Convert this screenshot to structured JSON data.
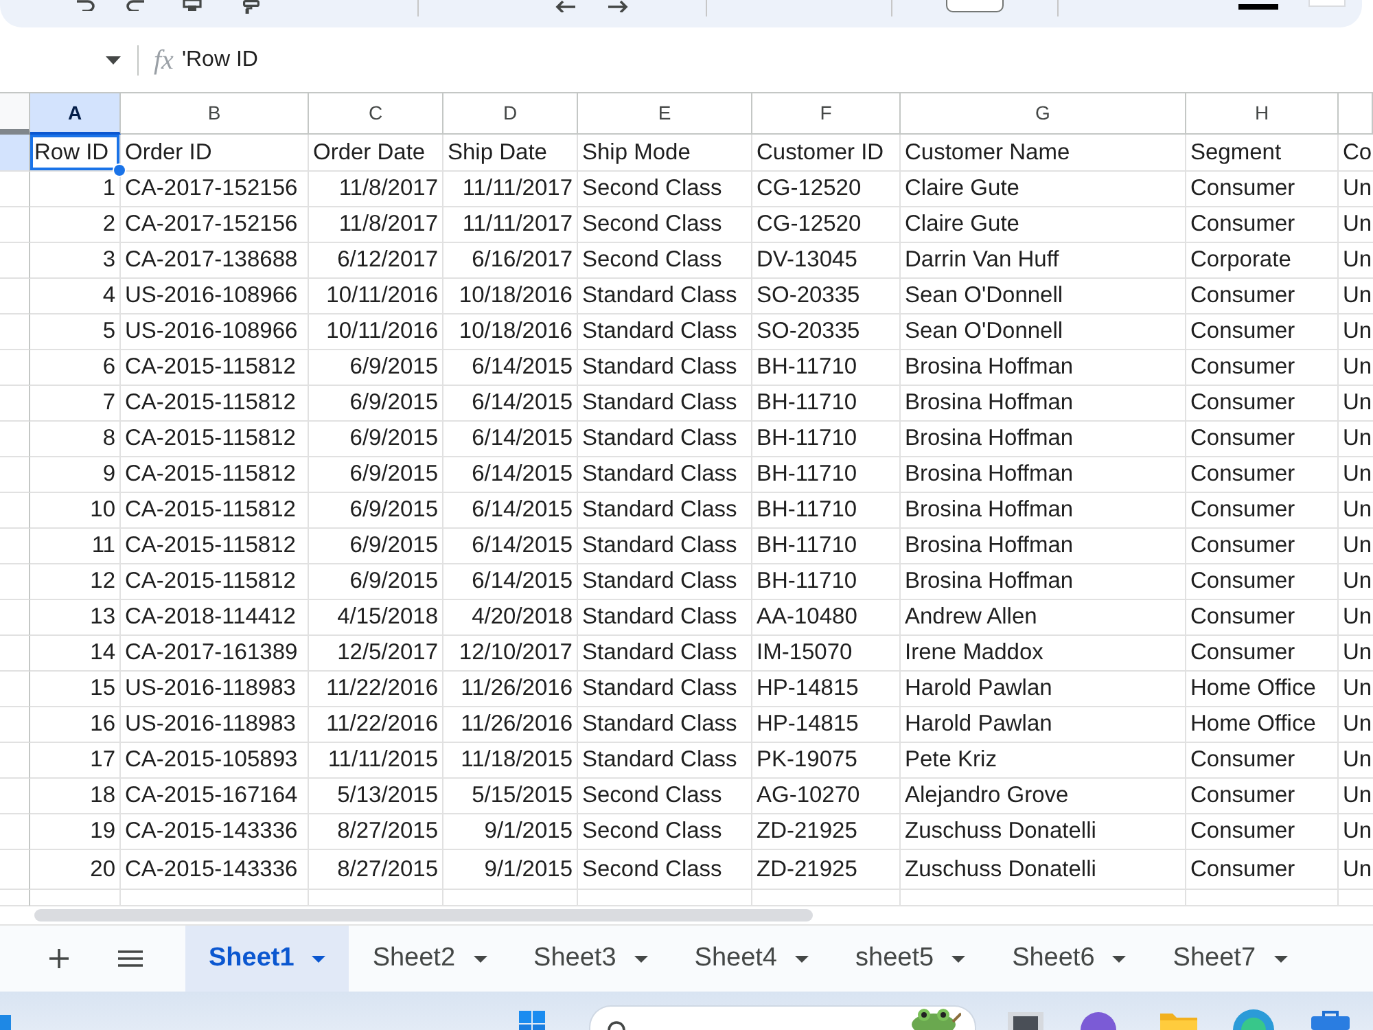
{
  "formula_bar": {
    "function_symbol": "fx",
    "formula": "'Row ID"
  },
  "grid": {
    "columns": [
      {
        "letter": "A",
        "selected": true,
        "kind": "number"
      },
      {
        "letter": "B",
        "selected": false,
        "kind": "text"
      },
      {
        "letter": "C",
        "selected": false,
        "kind": "date"
      },
      {
        "letter": "D",
        "selected": false,
        "kind": "date"
      },
      {
        "letter": "E",
        "selected": false,
        "kind": "text"
      },
      {
        "letter": "F",
        "selected": false,
        "kind": "text"
      },
      {
        "letter": "G",
        "selected": false,
        "kind": "text"
      },
      {
        "letter": "H",
        "selected": false,
        "kind": "text"
      },
      {
        "selected": false,
        "kind": "text"
      }
    ],
    "rows": [
      {
        "kind": "header",
        "selected": true,
        "cells": [
          "Row ID",
          "Order ID",
          "Order Date",
          "Ship Date",
          "Ship Mode",
          "Customer ID",
          "Customer Name",
          "Segment",
          "Co"
        ]
      },
      {
        "kind": "data",
        "selected": false,
        "cells": [
          "1",
          "CA-2017-152156",
          "11/8/2017",
          "11/11/2017",
          "Second Class",
          "CG-12520",
          "Claire Gute",
          "Consumer",
          "Un"
        ]
      },
      {
        "kind": "data",
        "selected": false,
        "cells": [
          "2",
          "CA-2017-152156",
          "11/8/2017",
          "11/11/2017",
          "Second Class",
          "CG-12520",
          "Claire Gute",
          "Consumer",
          "Un"
        ]
      },
      {
        "kind": "data",
        "selected": false,
        "cells": [
          "3",
          "CA-2017-138688",
          "6/12/2017",
          "6/16/2017",
          "Second Class",
          "DV-13045",
          "Darrin Van Huff",
          "Corporate",
          "Un"
        ]
      },
      {
        "kind": "data",
        "selected": false,
        "cells": [
          "4",
          "US-2016-108966",
          "10/11/2016",
          "10/18/2016",
          "Standard Class",
          "SO-20335",
          "Sean O'Donnell",
          "Consumer",
          "Un"
        ]
      },
      {
        "kind": "data",
        "selected": false,
        "cells": [
          "5",
          "US-2016-108966",
          "10/11/2016",
          "10/18/2016",
          "Standard Class",
          "SO-20335",
          "Sean O'Donnell",
          "Consumer",
          "Un"
        ]
      },
      {
        "kind": "data",
        "selected": false,
        "cells": [
          "6",
          "CA-2015-115812",
          "6/9/2015",
          "6/14/2015",
          "Standard Class",
          "BH-11710",
          "Brosina Hoffman",
          "Consumer",
          "Un"
        ]
      },
      {
        "kind": "data",
        "selected": false,
        "cells": [
          "7",
          "CA-2015-115812",
          "6/9/2015",
          "6/14/2015",
          "Standard Class",
          "BH-11710",
          "Brosina Hoffman",
          "Consumer",
          "Un"
        ]
      },
      {
        "kind": "data",
        "selected": false,
        "cells": [
          "8",
          "CA-2015-115812",
          "6/9/2015",
          "6/14/2015",
          "Standard Class",
          "BH-11710",
          "Brosina Hoffman",
          "Consumer",
          "Un"
        ]
      },
      {
        "kind": "data",
        "selected": false,
        "cells": [
          "9",
          "CA-2015-115812",
          "6/9/2015",
          "6/14/2015",
          "Standard Class",
          "BH-11710",
          "Brosina Hoffman",
          "Consumer",
          "Un"
        ]
      },
      {
        "kind": "data",
        "selected": false,
        "cells": [
          "10",
          "CA-2015-115812",
          "6/9/2015",
          "6/14/2015",
          "Standard Class",
          "BH-11710",
          "Brosina Hoffman",
          "Consumer",
          "Un"
        ]
      },
      {
        "kind": "data",
        "selected": false,
        "cells": [
          "11",
          "CA-2015-115812",
          "6/9/2015",
          "6/14/2015",
          "Standard Class",
          "BH-11710",
          "Brosina Hoffman",
          "Consumer",
          "Un"
        ]
      },
      {
        "kind": "data",
        "selected": false,
        "cells": [
          "12",
          "CA-2015-115812",
          "6/9/2015",
          "6/14/2015",
          "Standard Class",
          "BH-11710",
          "Brosina Hoffman",
          "Consumer",
          "Un"
        ]
      },
      {
        "kind": "data",
        "selected": false,
        "cells": [
          "13",
          "CA-2018-114412",
          "4/15/2018",
          "4/20/2018",
          "Standard Class",
          "AA-10480",
          "Andrew Allen",
          "Consumer",
          "Un"
        ]
      },
      {
        "kind": "data",
        "selected": false,
        "cells": [
          "14",
          "CA-2017-161389",
          "12/5/2017",
          "12/10/2017",
          "Standard Class",
          "IM-15070",
          "Irene Maddox",
          "Consumer",
          "Un"
        ]
      },
      {
        "kind": "data",
        "selected": false,
        "cells": [
          "15",
          "US-2016-118983",
          "11/22/2016",
          "11/26/2016",
          "Standard Class",
          "HP-14815",
          "Harold Pawlan",
          "Home Office",
          "Un"
        ]
      },
      {
        "kind": "data",
        "selected": false,
        "cells": [
          "16",
          "US-2016-118983",
          "11/22/2016",
          "11/26/2016",
          "Standard Class",
          "HP-14815",
          "Harold Pawlan",
          "Home Office",
          "Un"
        ]
      },
      {
        "kind": "data",
        "selected": false,
        "cells": [
          "17",
          "CA-2015-105893",
          "11/11/2015",
          "11/18/2015",
          "Standard Class",
          "PK-19075",
          "Pete Kriz",
          "Consumer",
          "Un"
        ]
      },
      {
        "kind": "data",
        "selected": false,
        "cells": [
          "18",
          "CA-2015-167164",
          "5/13/2015",
          "5/15/2015",
          "Second Class",
          "AG-10270",
          "Alejandro Grove",
          "Consumer",
          "Un"
        ]
      },
      {
        "kind": "data",
        "selected": false,
        "cells": [
          "19",
          "CA-2015-143336",
          "8/27/2015",
          "9/1/2015",
          "Second Class",
          "ZD-21925",
          "Zuschuss Donatelli",
          "Consumer",
          "Un"
        ]
      },
      {
        "kind": "data",
        "selected": false,
        "cells": [
          "20",
          "CA-2015-143336",
          "8/27/2015",
          "9/1/2015",
          "Second Class",
          "ZD-21925",
          "Zuschuss Donatelli",
          "Consumer",
          "Un"
        ]
      }
    ]
  },
  "sheet_tabs": [
    {
      "label": "Sheet1",
      "selected": true
    },
    {
      "label": "Sheet2",
      "selected": false
    },
    {
      "label": "Sheet3",
      "selected": false
    },
    {
      "label": "Sheet4",
      "selected": false
    },
    {
      "label": "sheet5",
      "selected": false
    },
    {
      "label": "Sheet6",
      "selected": false
    },
    {
      "label": "Sheet7",
      "selected": false
    }
  ]
}
